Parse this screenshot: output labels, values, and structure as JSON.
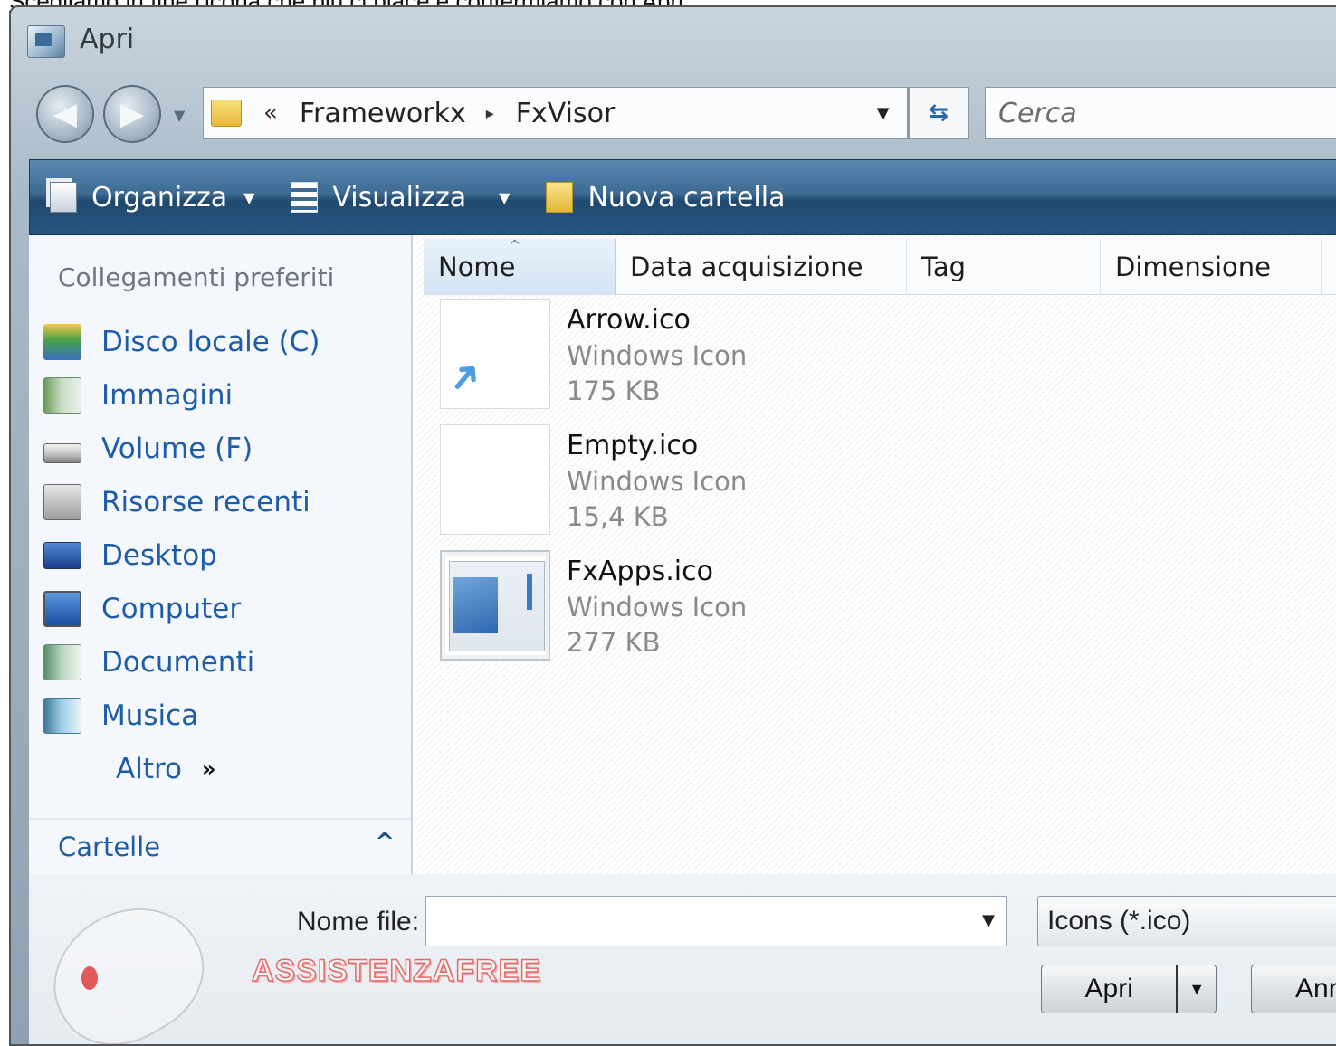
{
  "caption": "Scegliamo in fine l'icona che più ci piace e confermiamo con Apri",
  "window": {
    "title": "Apri"
  },
  "navigation": {
    "back_icon": "back-arrow-icon",
    "forward_icon": "forward-arrow-icon",
    "breadcrumb_overflow": "«",
    "breadcrumbs": [
      "Frameworkx",
      "FxVisor"
    ],
    "breadcrumb_separator": "▸",
    "refresh_icon": "refresh-icon",
    "search_placeholder": "Cerca"
  },
  "toolbar": {
    "organize": "Organizza",
    "views": "Visualizza",
    "new_folder": "Nuova cartella",
    "caret": "▼"
  },
  "sidebar": {
    "favorites_header": "Collegamenti preferiti",
    "items": [
      {
        "label": "Disco locale (C)",
        "icon": "local-disk-icon"
      },
      {
        "label": "Immagini",
        "icon": "pictures-icon"
      },
      {
        "label": "Volume (F)",
        "icon": "drive-icon"
      },
      {
        "label": "Risorse recenti",
        "icon": "recent-icon"
      },
      {
        "label": "Desktop",
        "icon": "desktop-icon"
      },
      {
        "label": "Computer",
        "icon": "computer-icon"
      },
      {
        "label": "Documenti",
        "icon": "documents-icon"
      },
      {
        "label": "Musica",
        "icon": "music-icon"
      }
    ],
    "more_label": "Altro",
    "more_icon": "»",
    "folders_label": "Cartelle",
    "folders_toggle": "^"
  },
  "columns": [
    "Nome",
    "Data acquisizione",
    "Tag",
    "Dimensione"
  ],
  "sort_indicator": "^",
  "files": [
    {
      "name": "Arrow.ico",
      "type": "Windows Icon",
      "size": "175 KB",
      "thumb": "arrow-thumbnail"
    },
    {
      "name": "Empty.ico",
      "type": "Windows Icon",
      "size": "15,4 KB",
      "thumb": "empty-thumbnail"
    },
    {
      "name": "FxApps.ico",
      "type": "Windows Icon",
      "size": "277 KB",
      "thumb": "fxapps-thumbnail"
    }
  ],
  "footer": {
    "filename_label": "Nome file:",
    "filename_value": "",
    "filetype": "Icons (*.ico)",
    "open_button": "Apri",
    "cancel_button": "Annulla",
    "dropdown_arrow": "▼"
  },
  "watermark": {
    "text": "ASSISTENZAFREE"
  },
  "colors": {
    "link": "#1e5ca8",
    "toolbar": "#2a5680",
    "accent_red": "#e06a6a"
  }
}
